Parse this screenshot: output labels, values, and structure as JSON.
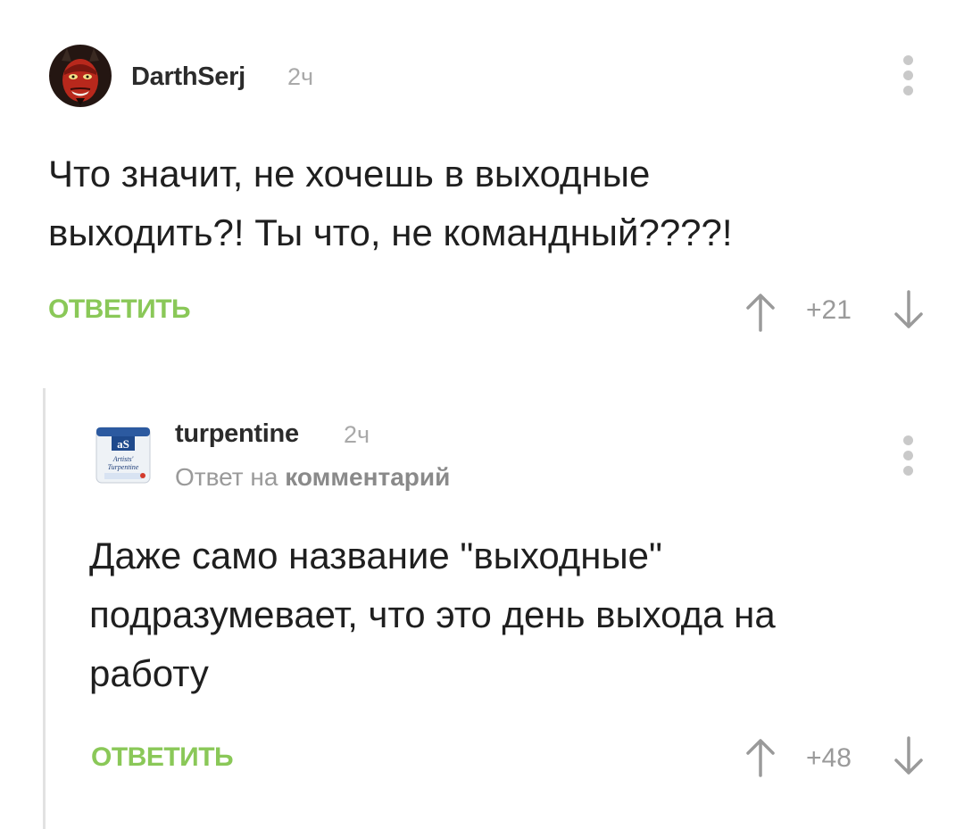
{
  "comments": [
    {
      "author": "DarthSerj",
      "time": "2ч",
      "text": "Что значит, не хочешь в выходные\nвыходить?! Ты что, не командный????!",
      "reply_label": "ОТВЕТИТЬ",
      "score": "+21",
      "avatar_icon": "devil-face-avatar"
    },
    {
      "author": "turpentine",
      "time": "2ч",
      "reply_to_prefix": "Ответ на",
      "reply_to_link": "комментарий",
      "text": "Даже само название \"выходные\"\nподразумевает, что это день выхода на\nработу",
      "reply_label": "ОТВЕТИТЬ",
      "score": "+48",
      "avatar_icon": "turpentine-can-avatar",
      "avatar_text": {
        "brand": "aS",
        "line1": "Artists'",
        "line2": "Turpentine"
      }
    }
  ],
  "colors": {
    "accent_green": "#8ac858",
    "muted_gray": "#9a9a9a",
    "text": "#1f1f1f"
  }
}
